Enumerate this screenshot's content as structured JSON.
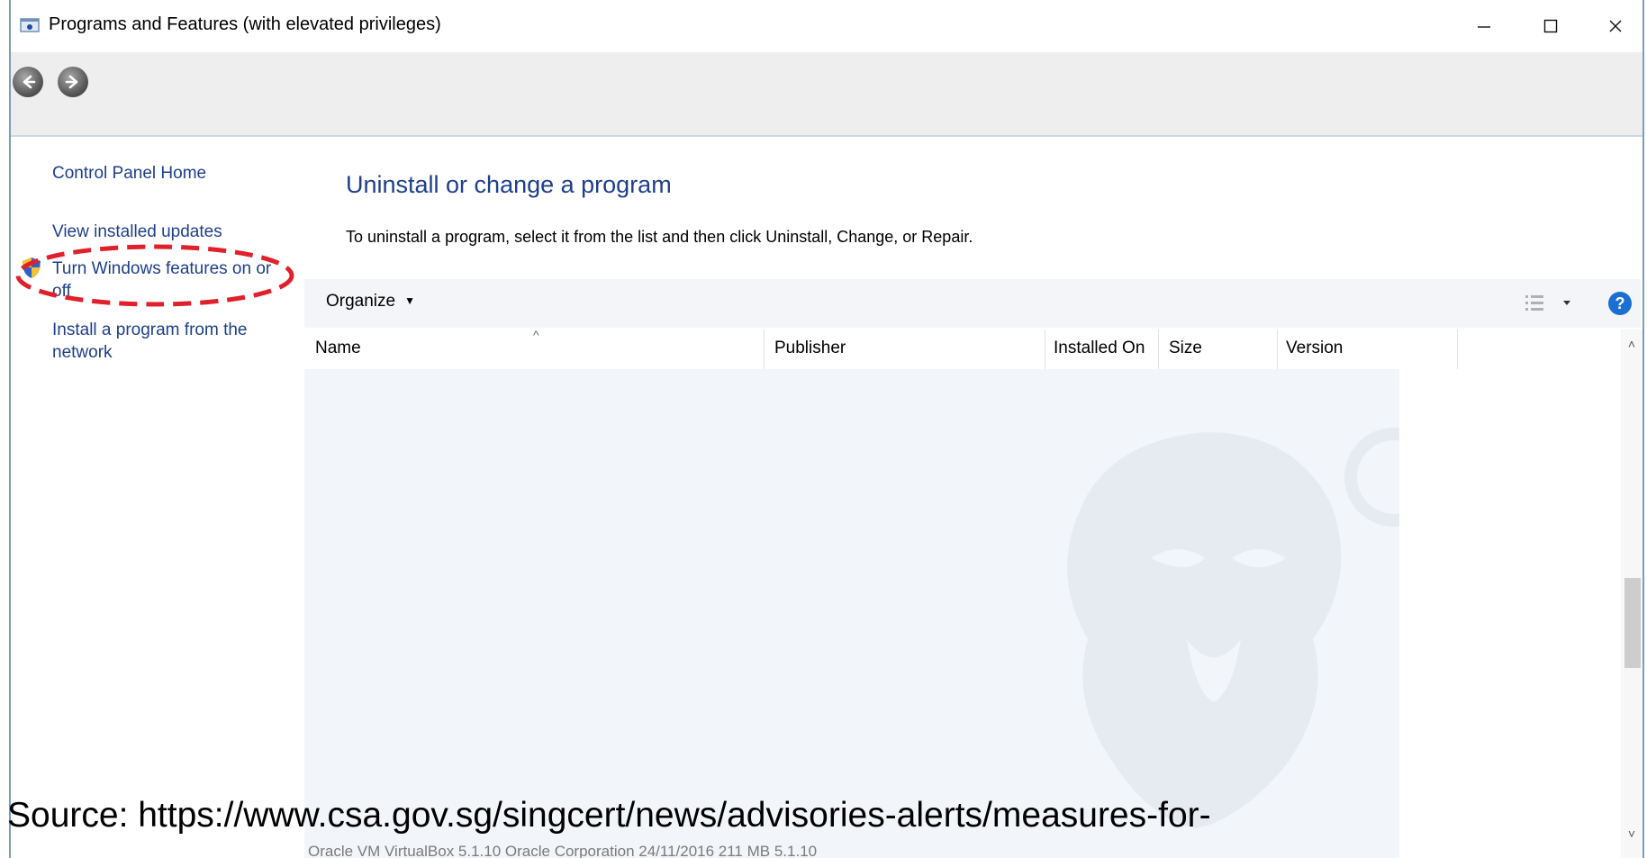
{
  "window": {
    "title": "Programs and Features (with elevated privileges)",
    "minimize_glyph": "—",
    "maximize_glyph": "☐",
    "close_glyph": "✕"
  },
  "nav": {
    "back_icon": "back-arrow-icon",
    "forward_icon": "forward-arrow-icon"
  },
  "sidebar": {
    "items": [
      {
        "label": "Control Panel Home"
      },
      {
        "label": "View installed updates"
      },
      {
        "label": "Turn Windows features on or off",
        "icon": "uac-shield-icon",
        "highlighted": true
      },
      {
        "label": "Install a program from the network"
      }
    ]
  },
  "main": {
    "heading": "Uninstall or change a program",
    "instructions": "To uninstall a program, select it from the list and then click Uninstall, Change, or Repair."
  },
  "toolbar": {
    "organize_label": "Organize",
    "help_label": "?"
  },
  "table": {
    "columns": [
      "Name",
      "Publisher",
      "Installed On",
      "Size",
      "Version"
    ],
    "sorted_by": "Name",
    "partial_row_text": "Oracle VM VirtualBox 5.1.10        Oracle Corporation             24/11/2016     211 MB     5.1.10"
  },
  "overlay": {
    "source_text": "Source: https://www.csa.gov.sg/singcert/news/advisories-alerts/measures-for-",
    "highlight_color": "#e0202a"
  },
  "colors": {
    "link": "#1e3f8a",
    "help": "#1a6fd1",
    "list_bg": "#f2f5f9"
  }
}
